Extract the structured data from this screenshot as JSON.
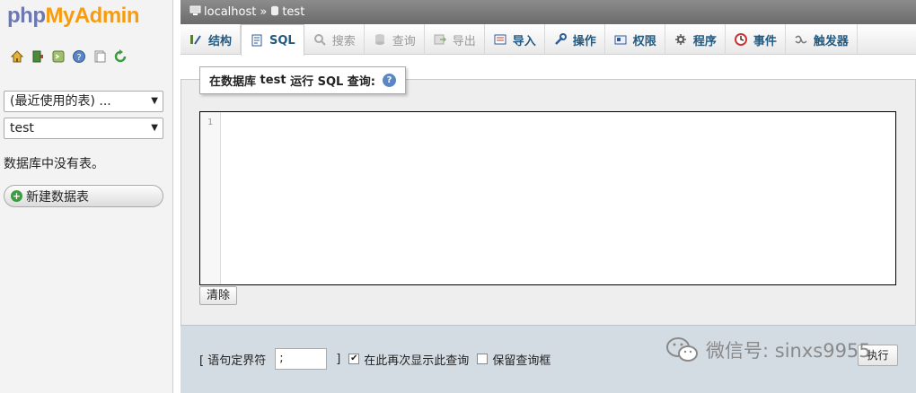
{
  "sidebar": {
    "logo": {
      "php": "php",
      "my": "My",
      "admin": "Admin"
    },
    "icons": [
      "home-icon",
      "exit-icon",
      "console-icon",
      "help-icon",
      "docs-icon",
      "reload-icon"
    ],
    "recent_select": "(最近使用的表) ...",
    "db_select": "test",
    "no_tables": "数据库中没有表。",
    "new_table": "新建数据表"
  },
  "breadcrumb": {
    "server": "localhost",
    "separator": "»",
    "database": "test"
  },
  "tabs": [
    {
      "label": "结构",
      "icon": "structure-icon",
      "state": "normal"
    },
    {
      "label": "SQL",
      "icon": "sql-icon",
      "state": "active"
    },
    {
      "label": "搜索",
      "icon": "search-icon",
      "state": "disabled"
    },
    {
      "label": "查询",
      "icon": "query-icon",
      "state": "disabled"
    },
    {
      "label": "导出",
      "icon": "export-icon",
      "state": "disabled"
    },
    {
      "label": "导入",
      "icon": "import-icon",
      "state": "normal"
    },
    {
      "label": "操作",
      "icon": "wrench-icon",
      "state": "normal"
    },
    {
      "label": "权限",
      "icon": "privileges-icon",
      "state": "normal"
    },
    {
      "label": "程序",
      "icon": "routines-icon",
      "state": "normal"
    },
    {
      "label": "事件",
      "icon": "events-icon",
      "state": "normal"
    },
    {
      "label": "触发器",
      "icon": "triggers-icon",
      "state": "normal"
    }
  ],
  "query": {
    "legend_prefix": "在数据库",
    "legend_db": "test",
    "legend_suffix": "运行 SQL 查询:",
    "line_number": "1",
    "clear_label": "清除"
  },
  "options": {
    "delimiter_open": "[ 语句定界符",
    "delimiter_value": ";",
    "delimiter_close": "]",
    "show_again_label": "在此再次显示此查询",
    "show_again_checked": true,
    "keep_box_label": "保留查询框",
    "keep_box_checked": false,
    "go_label": "执行"
  },
  "watermark": {
    "text": "微信号: sinxs9955"
  },
  "colors": {
    "tab_text": "#235a81",
    "logo_php": "#6c78af",
    "logo_myadmin": "#f89c0e",
    "options_bg": "#d4dce3"
  }
}
